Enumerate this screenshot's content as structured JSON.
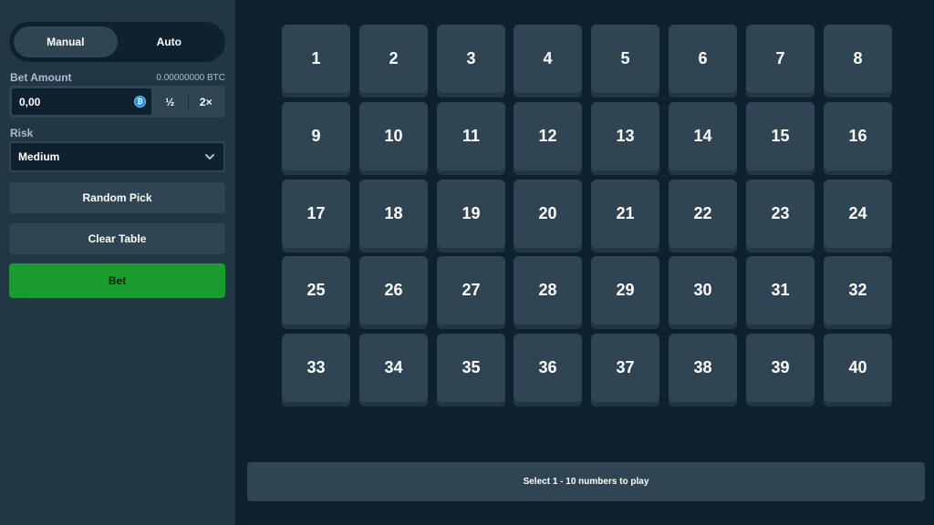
{
  "sidebar": {
    "modes": [
      {
        "label": "Manual",
        "active": true
      },
      {
        "label": "Auto",
        "active": false
      }
    ],
    "bet_amount": {
      "label": "Bet Amount",
      "balance": "0.00000000 BTC",
      "value": "0,00",
      "coin_icon": "bitcoin-coin-icon",
      "half_label": "½",
      "double_label": "2×"
    },
    "risk": {
      "label": "Risk",
      "selected": "Medium"
    },
    "random_pick_label": "Random Pick",
    "clear_table_label": "Clear Table",
    "bet_label": "Bet"
  },
  "board": {
    "numbers": [
      "1",
      "2",
      "3",
      "4",
      "5",
      "6",
      "7",
      "8",
      "9",
      "10",
      "11",
      "12",
      "13",
      "14",
      "15",
      "16",
      "17",
      "18",
      "19",
      "20",
      "21",
      "22",
      "23",
      "24",
      "25",
      "26",
      "27",
      "28",
      "29",
      "30",
      "31",
      "32",
      "33",
      "34",
      "35",
      "36",
      "37",
      "38",
      "39",
      "40"
    ],
    "message": "Select 1 - 10 numbers to play"
  },
  "colors": {
    "background": "#0f212e",
    "sidebar": "#213743",
    "tile": "#2f4553",
    "bet_button": "#1a9b2d"
  }
}
